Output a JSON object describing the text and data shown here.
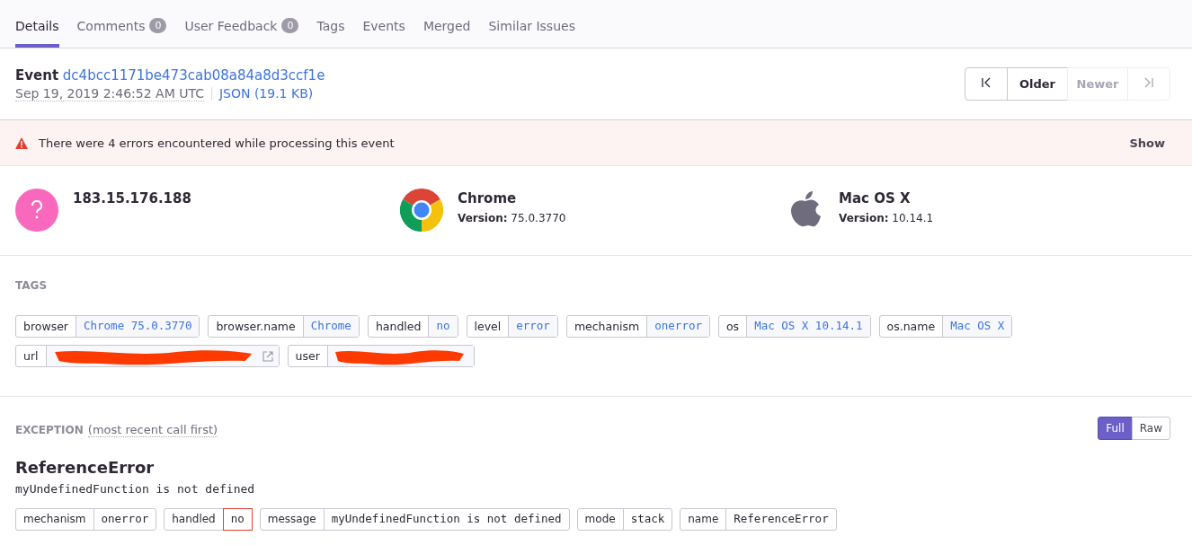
{
  "tabs": [
    {
      "label": "Details",
      "selected": true
    },
    {
      "label": "Comments",
      "count": "0",
      "selected": false
    },
    {
      "label": "User Feedback",
      "count": "0",
      "selected": false
    },
    {
      "label": "Tags",
      "selected": false
    },
    {
      "label": "Events",
      "selected": false
    },
    {
      "label": "Merged",
      "selected": false
    },
    {
      "label": "Similar Issues",
      "selected": false
    }
  ],
  "event": {
    "label": "Event",
    "id": "dc4bcc1171be473cab08a84a8d3ccf1e",
    "date": "Sep 19, 2019 2:46:52 AM UTC",
    "json_link": "JSON (19.1 KB)"
  },
  "pager": [
    {
      "kind": "first",
      "disabled": false
    },
    {
      "kind": "text",
      "label": "Older",
      "disabled": false
    },
    {
      "kind": "text",
      "label": "Newer",
      "disabled": true
    },
    {
      "kind": "last",
      "disabled": true
    }
  ],
  "alert": {
    "message": "There were 4 errors encountered while processing this event",
    "action": "Show"
  },
  "context": [
    {
      "kind": "user",
      "title": "183.15.176.188"
    },
    {
      "kind": "browser",
      "title": "Chrome",
      "version_label": "Version:",
      "version": "75.0.3770"
    },
    {
      "kind": "os",
      "title": "Mac OS X",
      "version_label": "Version:",
      "version": "10.14.1"
    }
  ],
  "tags": {
    "heading": "TAGS",
    "items": [
      {
        "key": "browser",
        "value": "Chrome 75.0.3770"
      },
      {
        "key": "browser.name",
        "value": "Chrome"
      },
      {
        "key": "handled",
        "value": "no"
      },
      {
        "key": "level",
        "value": "error"
      },
      {
        "key": "mechanism",
        "value": "onerror"
      },
      {
        "key": "os",
        "value": "Mac OS X 10.14.1"
      },
      {
        "key": "os.name",
        "value": "Mac OS X"
      },
      {
        "key": "url",
        "redacted": true,
        "external_link": true
      },
      {
        "key": "user",
        "redacted": true
      }
    ]
  },
  "exception": {
    "heading": "EXCEPTION",
    "subheading": "(most recent call first)",
    "view_toggle": [
      {
        "label": "Full",
        "selected": true
      },
      {
        "label": "Raw",
        "selected": false
      }
    ],
    "type": "ReferenceError",
    "message": "myUndefinedFunction is not defined",
    "mechanism": [
      {
        "key": "mechanism",
        "value": "onerror",
        "warning": false
      },
      {
        "key": "handled",
        "value": "no",
        "warning": true
      },
      {
        "key": "message",
        "value": "myUndefinedFunction is not defined",
        "warning": false
      },
      {
        "key": "mode",
        "value": "stack",
        "warning": false
      },
      {
        "key": "name",
        "value": "ReferenceError",
        "warning": false
      }
    ]
  }
}
